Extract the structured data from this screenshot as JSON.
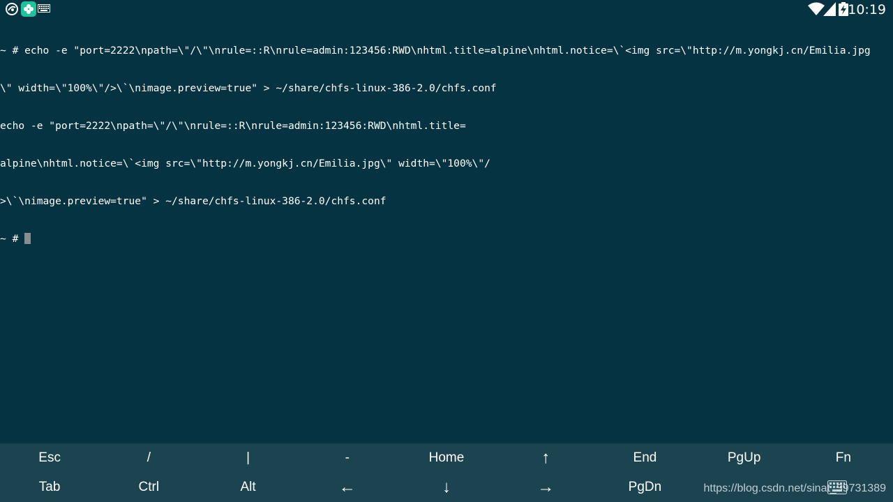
{
  "status_bar": {
    "time": "10:19",
    "left_icons": [
      "app-notification-icon",
      "clover-app-icon",
      "keyboard-notification-icon"
    ],
    "right_icons": [
      "wifi-icon",
      "cellular-signal-icon",
      "battery-charging-icon"
    ]
  },
  "terminal": {
    "lines": [
      "~ # echo -e \"port=2222\\npath=\\\"/\\\"\\nrule=::R\\nrule=admin:123456:RWD\\nhtml.title=alpine\\nhtml.notice=\\`<img src=\\\"http://m.yongkj.cn/Emilia.jpg",
      "\\\" width=\\\"100%\\\"/>\\`\\nimage.preview=true\" > ~/share/chfs-linux-386-2.0/chfs.conf",
      "echo -e \"port=2222\\npath=\\\"/\\\"\\nrule=::R\\nrule=admin:123456:RWD\\nhtml.title=",
      "alpine\\nhtml.notice=\\`<img src=\\\"http://m.yongkj.cn/Emilia.jpg\\\" width=\\\"100%\\\"/",
      ">\\`\\nimage.preview=true\" > ~/share/chfs-linux-386-2.0/chfs.conf"
    ],
    "prompt": "~ # "
  },
  "extra_keys": {
    "row1": [
      "Esc",
      "/",
      "|",
      "-",
      "Home",
      "↑",
      "End",
      "PgUp",
      "Fn"
    ],
    "row2": [
      "Tab",
      "Ctrl",
      "Alt",
      "←",
      "↓",
      "→",
      "PgDn",
      "",
      ""
    ]
  },
  "watermark": "https://blog.csdn.net/sinat_39731389",
  "colors": {
    "background": "#063341",
    "extra_keys_bg": "#1c4450",
    "text": "#ffffff",
    "cursor": "#8c8c8c",
    "app_icon_green": "#1fc39a"
  }
}
